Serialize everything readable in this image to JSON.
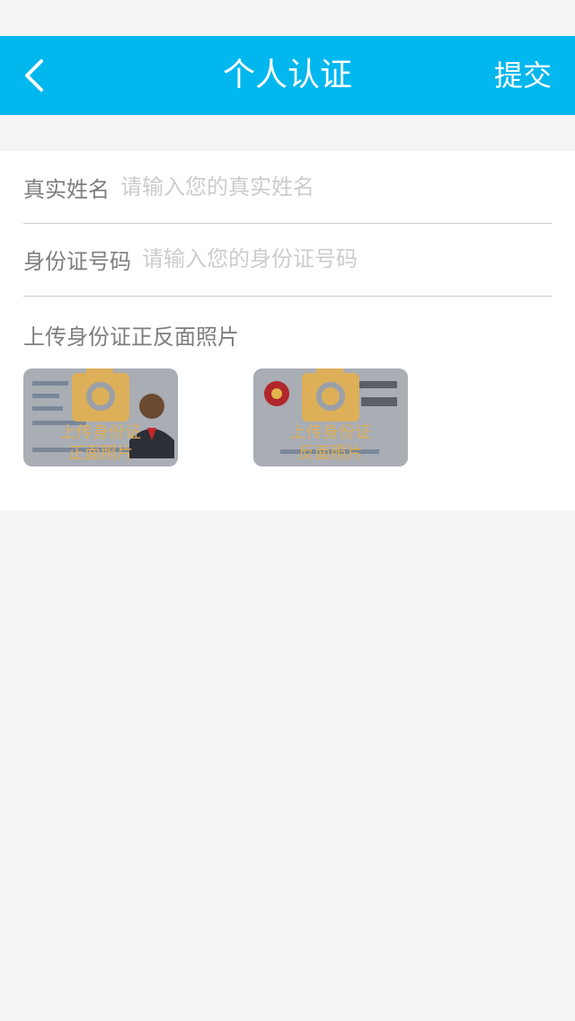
{
  "header": {
    "title": "个人认证",
    "submit_label": "提交",
    "background": "#00b7ee"
  },
  "form": {
    "name_label": "真实姓名",
    "name_placeholder": "请输入您的真实姓名",
    "id_label": "身份证号码",
    "id_placeholder": "请输入您的身份证号码",
    "label_color": "#7e7e7e",
    "placeholder_color": "#cccccc"
  },
  "upload": {
    "title": "上传身份证正反面照片",
    "front_line1": "上传身份证",
    "front_line2": "正面照片",
    "back_line1": "上传身份证",
    "back_line2": "反面照片",
    "accent_color": "#ddaf59"
  },
  "page": {
    "background": "#f3f4f5"
  },
  "icons": [
    "back-arrow-icon",
    "camera-icon"
  ]
}
